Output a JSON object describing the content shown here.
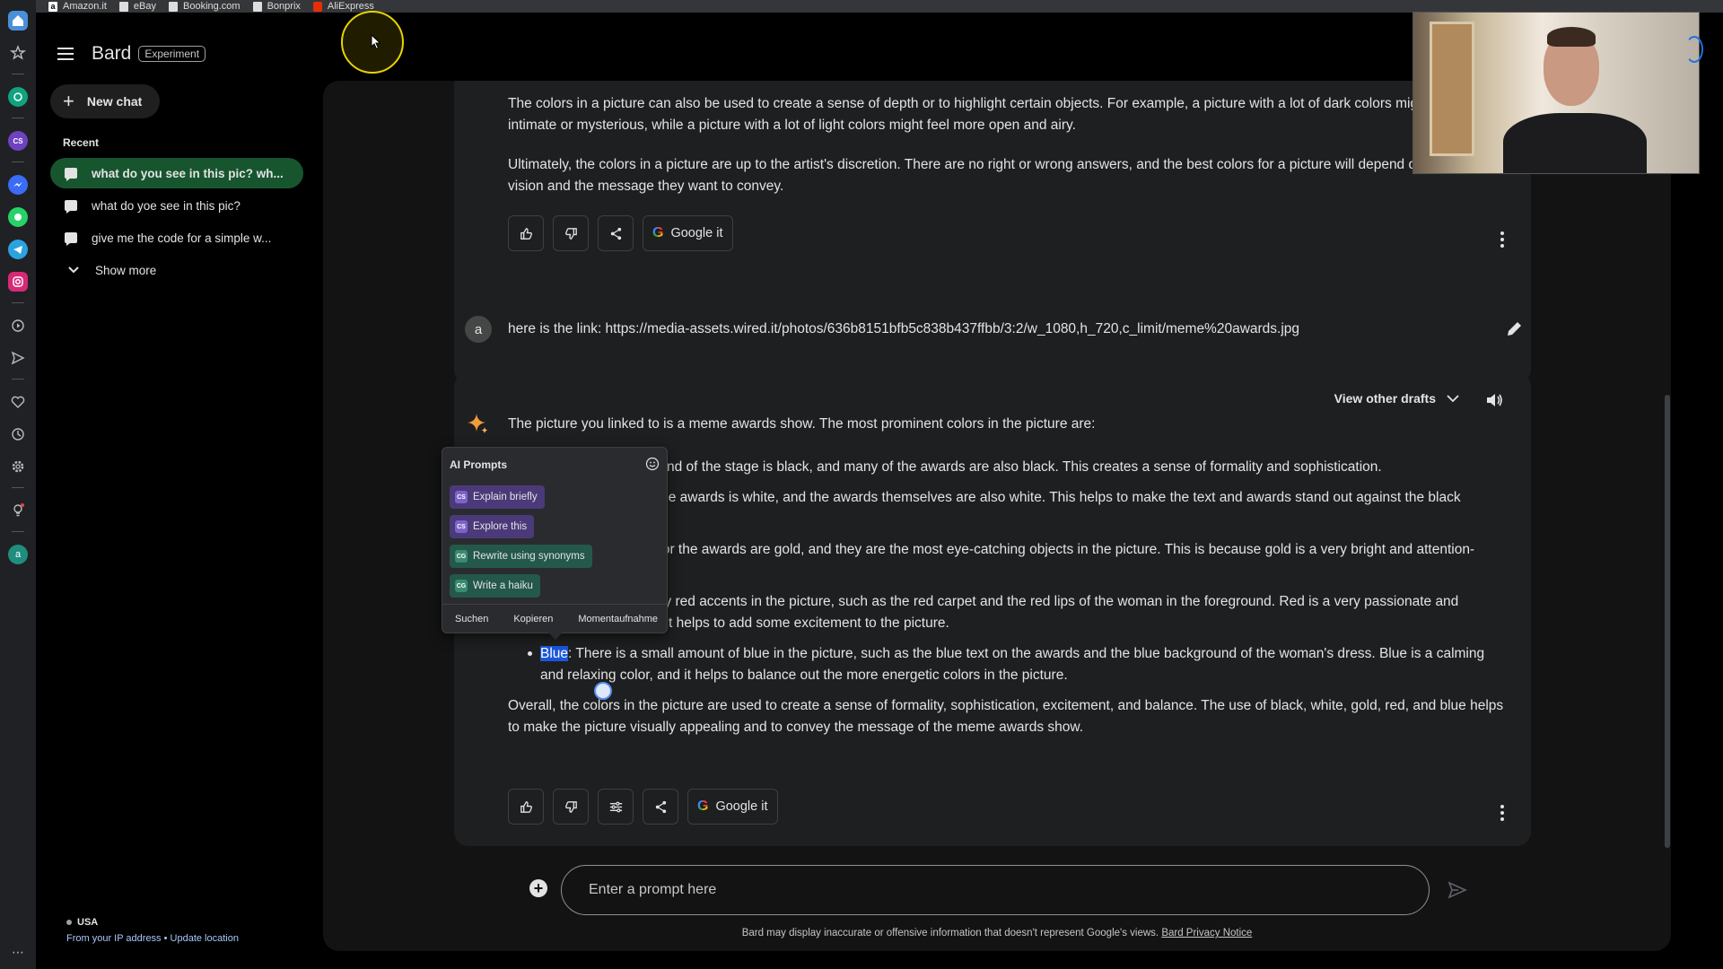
{
  "bookmarks": [
    "Amazon.it",
    "eBay",
    "Booking.com",
    "Bonprix",
    "AliExpress"
  ],
  "sidebar": {
    "brand": "Bard",
    "badge": "Experiment",
    "new_chat": "New chat",
    "recent_title": "Recent",
    "recent": [
      {
        "label": "what do you see in this pic? wh...",
        "active": true
      },
      {
        "label": "what do yoe see in this pic?",
        "active": false
      },
      {
        "label": "give me the code for a simple w...",
        "active": false
      }
    ],
    "show_more": "Show more",
    "location": {
      "country": "USA",
      "source": "From your IP address",
      "separator": " • ",
      "update": "Update location"
    }
  },
  "chat": {
    "prev_response": {
      "p1": "The colors in a picture can also be used to create a sense of depth or to highlight certain objects. For example, a picture with a lot of dark colors might feel more intimate or mysterious, while a picture with a lot of light colors might feel more open and airy.",
      "p2": "Ultimately, the colors in a picture are up to the artist's discretion. There are no right or wrong answers, and the best colors for a picture will depend on the artist's vision and the message they want to convey.",
      "google_it": "Google it"
    },
    "user_message": {
      "avatar_letter": "a",
      "text": "here is the link: https://media-assets.wired.it/photos/636b8151bfb5c838b437ffbb/3:2/w_1080,h_720,c_limit/meme%20awards.jpg"
    },
    "response": {
      "view_drafts": "View other drafts",
      "intro": "The picture you linked to is a meme awards show. The most prominent colors in the picture are:",
      "bullets": [
        "Black: The background of the stage is black, and many of the awards are also black. This creates a sense of formality and sophistication.",
        "White: The text on the awards is white, and the awards themselves are also white. This helps to make the text and awards stand out against the black background.",
        "Gold: The trophies for the awards are gold, and they are the most eye-catching objects in the picture. This is because gold is a very bright and attention-grabbing color.",
        "Red: There are many red accents in the picture, such as the red carpet and the red lips of the woman in the foreground. Red is a very passionate and energetic color, and it helps to add some excitement to the picture."
      ],
      "blue_term": "Blue",
      "blue_rest": ": There is a small amount of blue in the picture, such as the blue text on the awards and the blue background of the woman's dress. Blue is a calming and relaxing color, and it helps to balance out the more energetic colors in the picture.",
      "conclusion": "Overall, the colors in the picture are used to create a sense of formality, sophistication, excitement, and balance. The use of black, white, gold, red, and blue helps to make the picture visually appealing and to convey the message of the meme awards show.",
      "google_it": "Google it"
    }
  },
  "input": {
    "placeholder": "Enter a prompt here"
  },
  "disclaimer": {
    "text": "Bard may display inaccurate or offensive information that doesn't represent Google's views. ",
    "link": "Bard Privacy Notice"
  },
  "ai_prompts": {
    "title": "AI Prompts",
    "chips": [
      {
        "label": "Explain briefly",
        "badge": "CS",
        "style": "purple"
      },
      {
        "label": "Explore this",
        "badge": "CS",
        "style": "purple"
      },
      {
        "label": "Rewrite using synonyms",
        "badge": "CG",
        "style": "green"
      },
      {
        "label": "Write a haiku",
        "badge": "CG",
        "style": "green"
      }
    ],
    "footer": [
      "Suchen",
      "Kopieren",
      "Momentaufnahme"
    ]
  },
  "colors": {
    "active_chat": "#17552f",
    "panel": "#131314",
    "card": "#1e1f20",
    "highlight": "#1a56db"
  }
}
